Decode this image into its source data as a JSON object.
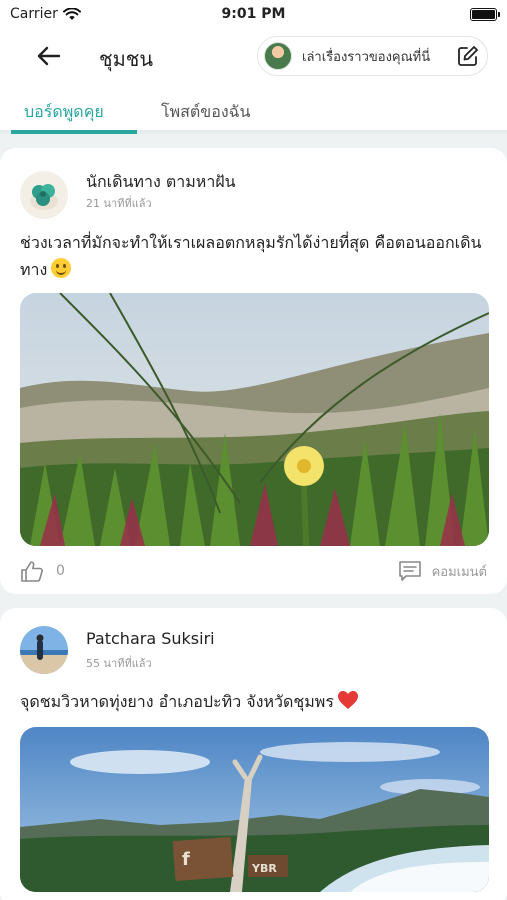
{
  "status_bar": {
    "carrier": "Carrier",
    "time": "9:01 PM"
  },
  "header": {
    "title": "ชุมชน",
    "story_button_label": "เล่าเรื่องราวของคุณที่นี่"
  },
  "tabs": [
    {
      "label": "บอร์ดพูดคุย",
      "active": true
    },
    {
      "label": "โพสต์ของฉัน",
      "active": false
    }
  ],
  "posts": [
    {
      "author": "นักเดินทาง ตามหาฝัน",
      "time": "21 นาทีที่แล้ว",
      "text": "ช่วงเวลาที่มักจะทำให้เราเผลอตกหลุมรักได้ง่ายที่สุด คือตอนออกเดินทาง",
      "emoji": "smile-emoji",
      "likes": "0",
      "comment_label": "คอมเมนต์"
    },
    {
      "author": "Patchara Suksiri",
      "time": "55 นาทีที่แล้ว",
      "text": "จุดชมวิวหาดทุ่งยาง อำเภอปะทิว จังหวัดชุมพร",
      "emoji": "heart-emoji",
      "sign_text": "f",
      "sign_text_2": "YBR"
    }
  ],
  "colors": {
    "accent": "#2aa6a0",
    "background": "#eef2f2",
    "muted": "#999999",
    "heart": "#e53935"
  }
}
